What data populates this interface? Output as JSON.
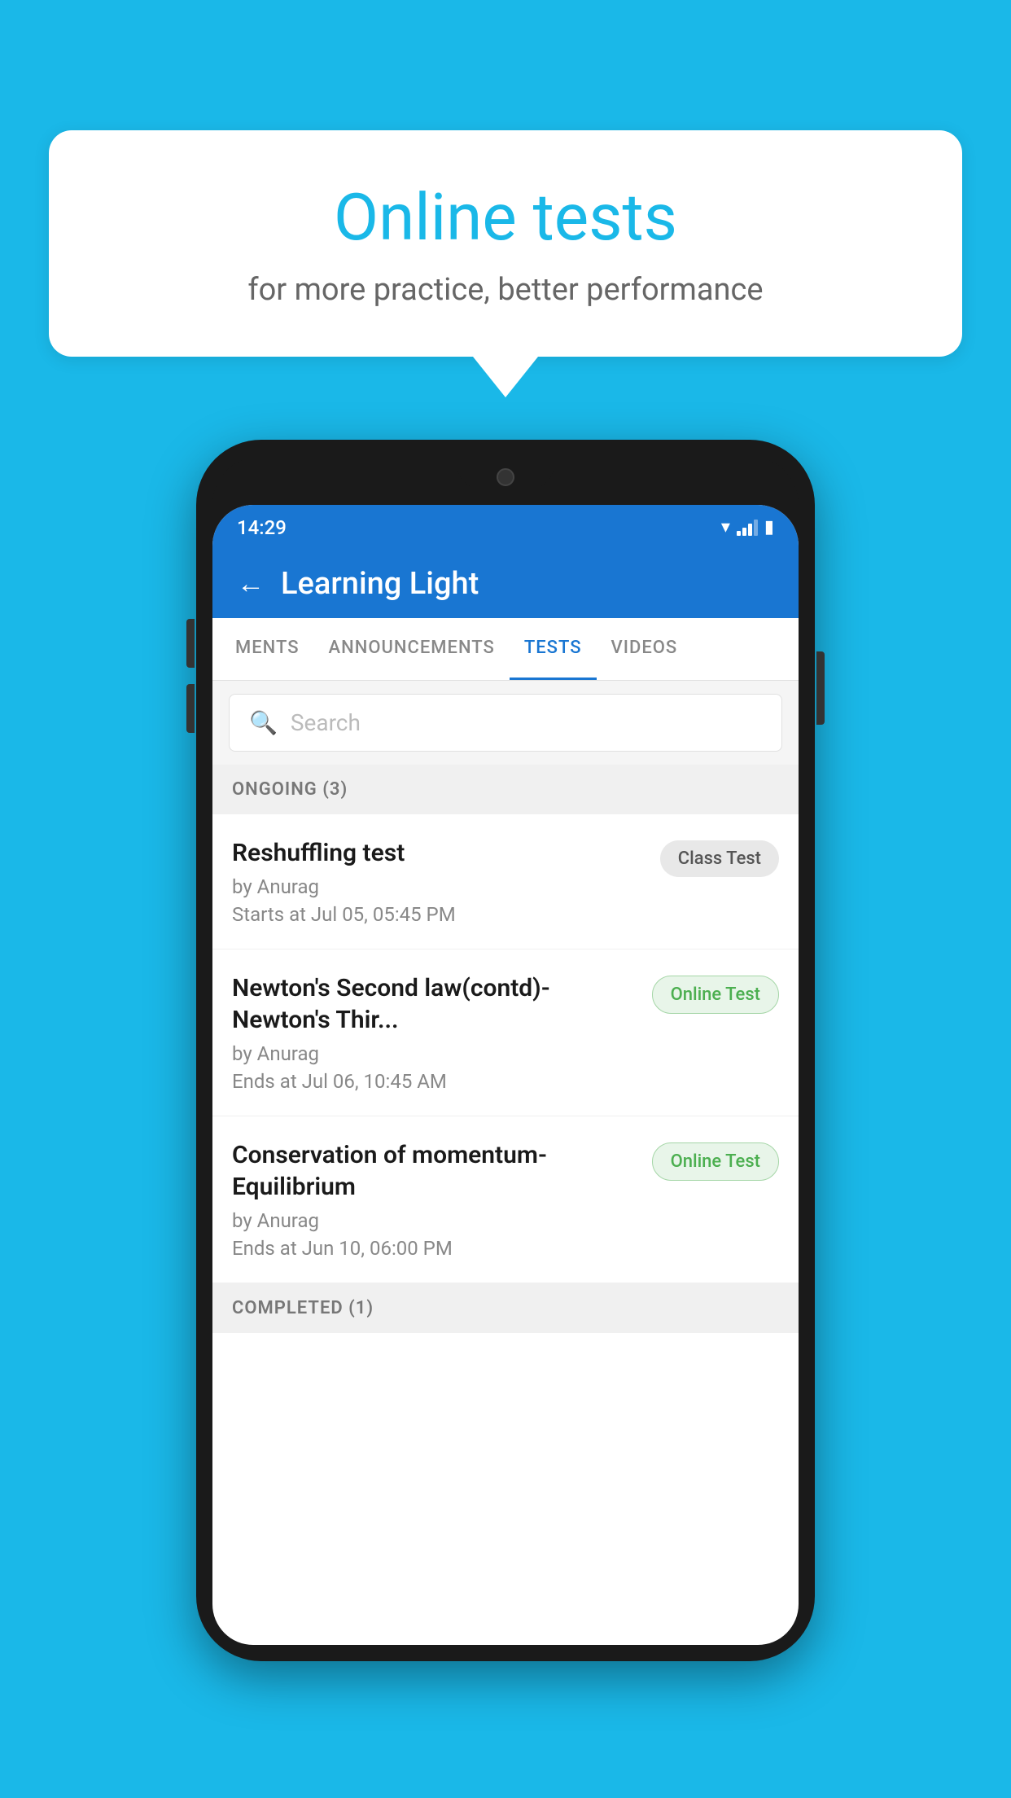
{
  "background": {
    "color": "#1ab8e8"
  },
  "speech_bubble": {
    "title": "Online tests",
    "subtitle": "for more practice, better performance"
  },
  "phone": {
    "status_bar": {
      "time": "14:29",
      "icons": [
        "wifi",
        "signal",
        "battery"
      ]
    },
    "header": {
      "back_label": "←",
      "title": "Learning Light"
    },
    "tabs": [
      {
        "label": "MENTS",
        "active": false
      },
      {
        "label": "ANNOUNCEMENTS",
        "active": false
      },
      {
        "label": "TESTS",
        "active": true
      },
      {
        "label": "VIDEOS",
        "active": false
      }
    ],
    "search": {
      "placeholder": "Search"
    },
    "sections": [
      {
        "title": "ONGOING (3)",
        "tests": [
          {
            "name": "Reshuffling test",
            "author": "by Anurag",
            "date": "Starts at  Jul 05, 05:45 PM",
            "badge": "Class Test",
            "badge_type": "class"
          },
          {
            "name": "Newton's Second law(contd)-Newton's Thir...",
            "author": "by Anurag",
            "date": "Ends at  Jul 06, 10:45 AM",
            "badge": "Online Test",
            "badge_type": "online"
          },
          {
            "name": "Conservation of momentum-Equilibrium",
            "author": "by Anurag",
            "date": "Ends at  Jun 10, 06:00 PM",
            "badge": "Online Test",
            "badge_type": "online"
          }
        ]
      },
      {
        "title": "COMPLETED (1)",
        "tests": []
      }
    ]
  }
}
